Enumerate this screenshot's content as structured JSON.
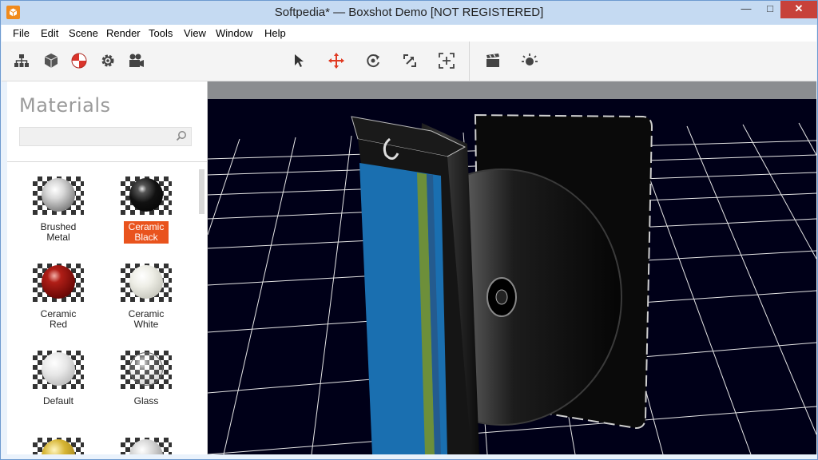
{
  "window": {
    "title": "Softpedia* — Boxshot Demo [NOT REGISTERED]"
  },
  "menu": [
    "File",
    "Edit",
    "Scene",
    "Render",
    "Tools",
    "View",
    "Window",
    "Help"
  ],
  "toolbar": {
    "left": [
      "scene-tree-icon",
      "object-cube-icon",
      "materials-icon",
      "settings-gear-icon",
      "camera-icon"
    ],
    "center": [
      "select-arrow-icon",
      "move-icon",
      "rotate-icon",
      "scale-icon",
      "fit-view-icon"
    ],
    "right": [
      "render-clapper-icon",
      "light-icon"
    ]
  },
  "sidebar": {
    "title": "Materials",
    "search": {
      "placeholder": "",
      "value": ""
    },
    "materials": [
      {
        "label": "Brushed Metal",
        "selected": false,
        "icon": "brushed-metal-icon"
      },
      {
        "label": "Ceramic Black",
        "selected": true,
        "icon": "ceramic-black-icon"
      },
      {
        "label": "Ceramic Red",
        "selected": false,
        "icon": "ceramic-red-icon"
      },
      {
        "label": "Ceramic White",
        "selected": false,
        "icon": "ceramic-white-icon"
      },
      {
        "label": "Default",
        "selected": false,
        "icon": "default-icon"
      },
      {
        "label": "Glass",
        "selected": false,
        "icon": "glass-icon"
      },
      {
        "label": "",
        "selected": false,
        "icon": "gold-icon"
      },
      {
        "label": "",
        "selected": false,
        "icon": "silver-icon"
      }
    ]
  },
  "colors": {
    "accent": "#e9531d",
    "viewport_bg": "#000018",
    "grid": "#e8e8e8",
    "box_blue": "#1a6fb0"
  }
}
